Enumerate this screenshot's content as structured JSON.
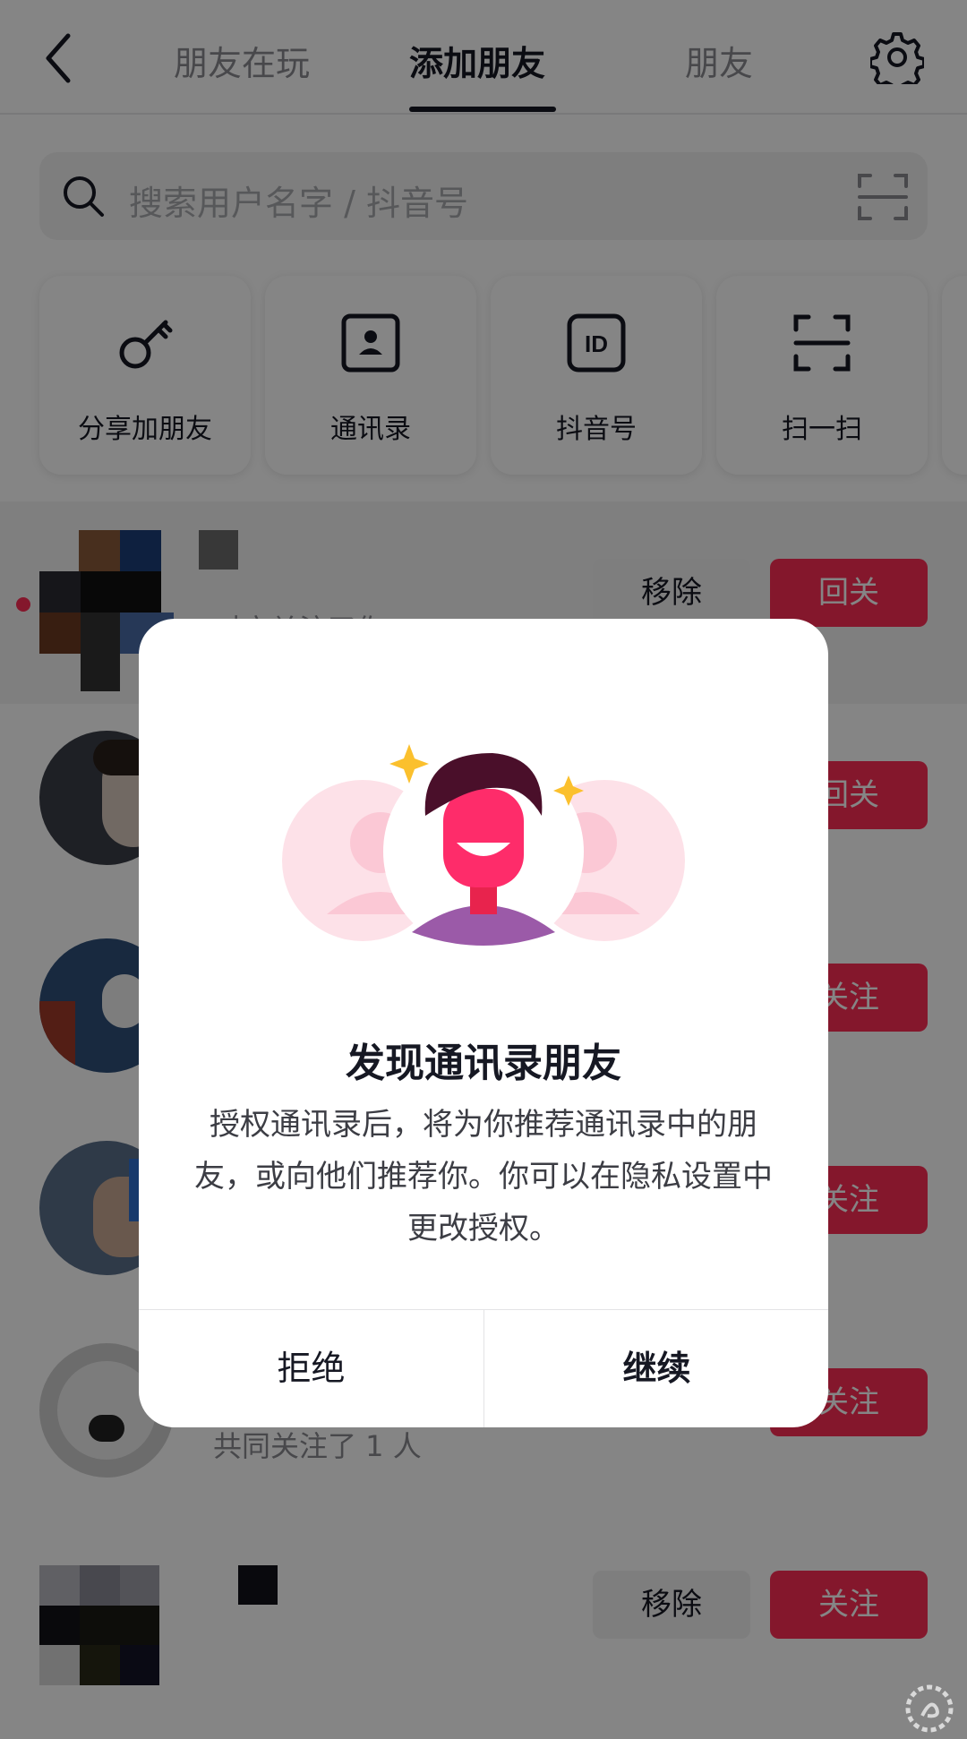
{
  "header": {
    "tabs": [
      "朋友在玩",
      "添加朋友",
      "朋友"
    ],
    "active_tab": "添加朋友"
  },
  "search": {
    "placeholder": "搜索用户名字 / 抖音号"
  },
  "quick_actions": [
    {
      "label": "分享加朋友",
      "icon": "key-icon"
    },
    {
      "label": "通讯录",
      "icon": "contacts-icon"
    },
    {
      "label": "抖音号",
      "icon": "id-icon"
    },
    {
      "label": "扫一扫",
      "icon": "scan-icon"
    }
  ],
  "list": [
    {
      "name": "",
      "subtitle": "对方关注了你",
      "secondary": "移除",
      "primary": "回关"
    },
    {
      "name": "",
      "subtitle": "",
      "secondary": "",
      "primary": "回关"
    },
    {
      "name": "",
      "subtitle": "",
      "secondary": "",
      "primary": "关注"
    },
    {
      "name": "",
      "subtitle": "",
      "secondary": "",
      "primary": "关注"
    },
    {
      "name": "",
      "subtitle": "共同关注了 1 人",
      "secondary": "",
      "primary": "关注"
    },
    {
      "name": "",
      "subtitle": "",
      "secondary": "移除",
      "primary": "关注"
    }
  ],
  "dialog": {
    "title": "发现通讯录朋友",
    "body": "授权通讯录后，将为你推荐通讯录中的朋友，或向他们推荐你。你可以在隐私设置中更改授权。",
    "reject": "拒绝",
    "continue": "继续"
  },
  "colors": {
    "accent": "#fe2c55",
    "text": "#161823",
    "overlay": "rgba(0,0,0,0.48)"
  }
}
